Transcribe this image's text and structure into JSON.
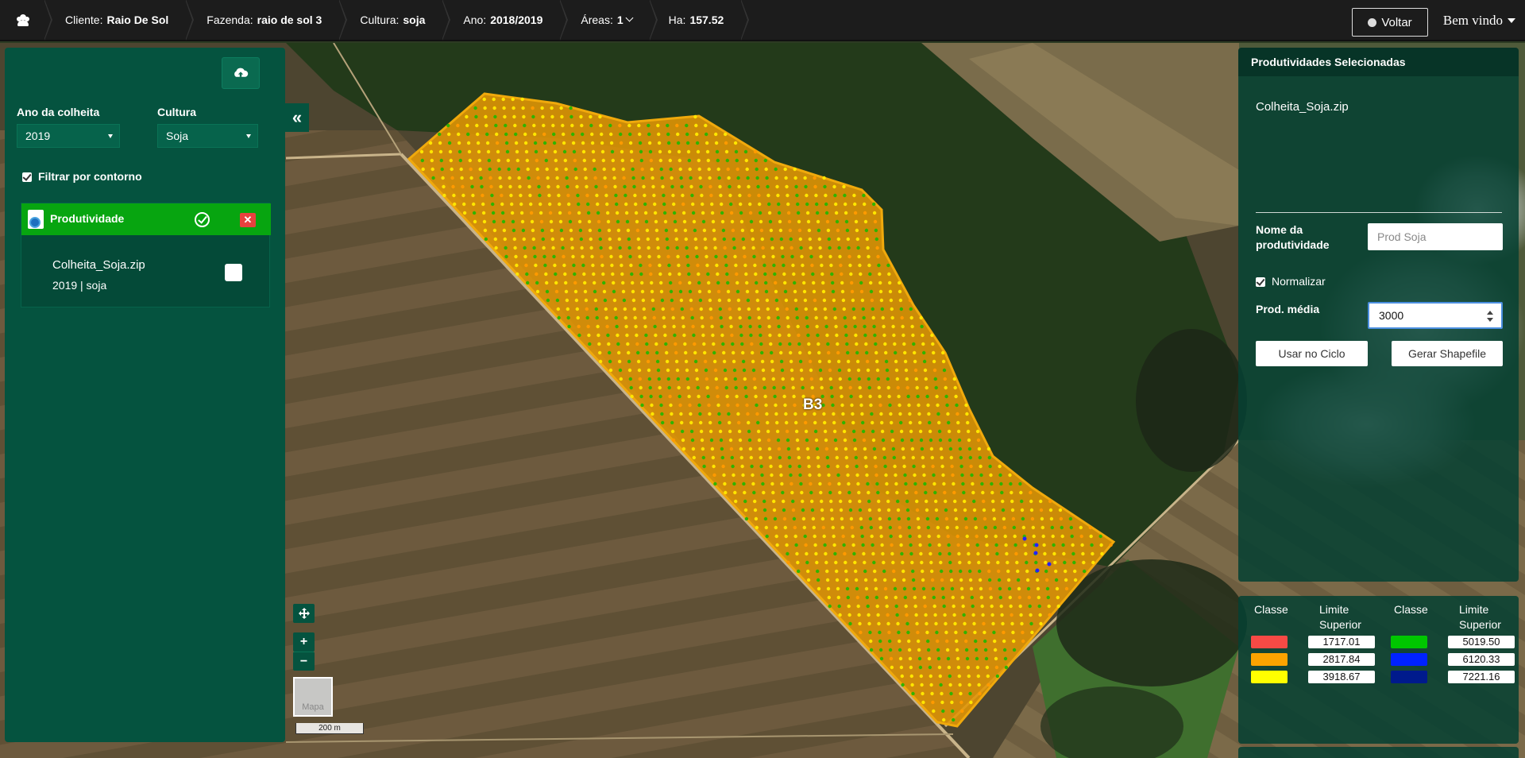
{
  "breadcrumb": {
    "home_icon": "users-icon",
    "items": [
      {
        "key": "Cliente:",
        "value": "Raio De Sol"
      },
      {
        "key": "Fazenda:",
        "value": "raio de sol 3"
      },
      {
        "key": "Cultura:",
        "value": "soja"
      },
      {
        "key": "Ano:",
        "value": "2018/2019"
      },
      {
        "key": "Áreas:",
        "value": "1"
      },
      {
        "key": "Ha:",
        "value": "157.52"
      }
    ]
  },
  "header": {
    "voltar_label": "Voltar",
    "welcome_label": "Bem vindo"
  },
  "left_panel": {
    "upload_icon": "cloud-upload-icon",
    "ano_label": "Ano da colheita",
    "ano_value": "2019",
    "cultura_label": "Cultura",
    "cultura_value": "Soja",
    "filtrar_label": "Filtrar por contorno",
    "filtrar_checked": true,
    "group_title": "Produtividade",
    "item": {
      "name": "Colheita_Soja.zip",
      "meta": "2019 | soja",
      "checked": false
    }
  },
  "map": {
    "field_label": "B3",
    "minimap_label": "Mapa",
    "scale_label": "200 m",
    "zoom_in": "+",
    "zoom_out": "−",
    "collapse": "«"
  },
  "right_panel": {
    "title": "Produtividades Selecionadas",
    "file": "Colheita_Soja.zip",
    "nome_label": "Nome da produtividade",
    "nome_placeholder": "Prod Soja",
    "normalizar_label": "Normalizar",
    "normalizar_checked": true,
    "prod_media_label": "Prod. média",
    "prod_media_value": "3000",
    "usar_label": "Usar no Ciclo",
    "gerar_label": "Gerar Shapefile"
  },
  "legend": {
    "classe_label": "Classe",
    "limite_label": "Limite Superior",
    "classes": [
      {
        "color": "#f74a45",
        "limit": "1717.01"
      },
      {
        "color": "#fba300",
        "limit": "2817.84"
      },
      {
        "color": "#ffff00",
        "limit": "3918.67"
      },
      {
        "color": "#00c600",
        "limit": "5019.50"
      },
      {
        "color": "#0022ff",
        "limit": "6120.33"
      },
      {
        "color": "#001a8c",
        "limit": "7221.16"
      }
    ]
  }
}
